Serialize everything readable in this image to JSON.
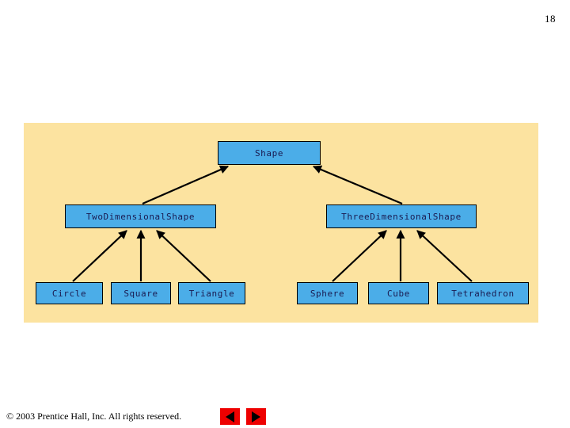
{
  "slide": {
    "page_number": "18",
    "panel_color": "#fce3a0",
    "box_fill_color": "#4bade8",
    "box_border_color": "#000000",
    "box_text_color": "#1a1a50"
  },
  "diagram": {
    "type": "inheritance-hierarchy",
    "arrow_direction": "child-to-parent",
    "nodes": {
      "shape": {
        "label": "Shape",
        "level": 1
      },
      "twodimensional": {
        "label": "TwoDimensionalShape",
        "level": 2
      },
      "threedimensional": {
        "label": "ThreeDimensionalShape",
        "level": 2
      },
      "circle": {
        "label": "Circle",
        "level": 3
      },
      "square": {
        "label": "Square",
        "level": 3
      },
      "triangle": {
        "label": "Triangle",
        "level": 3
      },
      "sphere": {
        "label": "Sphere",
        "level": 3
      },
      "cube": {
        "label": "Cube",
        "level": 3
      },
      "tetrahedron": {
        "label": "Tetrahedron",
        "level": 3
      }
    },
    "edges": [
      {
        "from": "twodimensional",
        "to": "shape"
      },
      {
        "from": "threedimensional",
        "to": "shape"
      },
      {
        "from": "circle",
        "to": "twodimensional"
      },
      {
        "from": "square",
        "to": "twodimensional"
      },
      {
        "from": "triangle",
        "to": "twodimensional"
      },
      {
        "from": "sphere",
        "to": "threedimensional"
      },
      {
        "from": "cube",
        "to": "threedimensional"
      },
      {
        "from": "tetrahedron",
        "to": "threedimensional"
      }
    ]
  },
  "footer": {
    "copyright": "© 2003 Prentice Hall, Inc.  All rights reserved.",
    "prev_label": "previous-slide",
    "next_label": "next-slide",
    "button_color": "#ee0000"
  }
}
